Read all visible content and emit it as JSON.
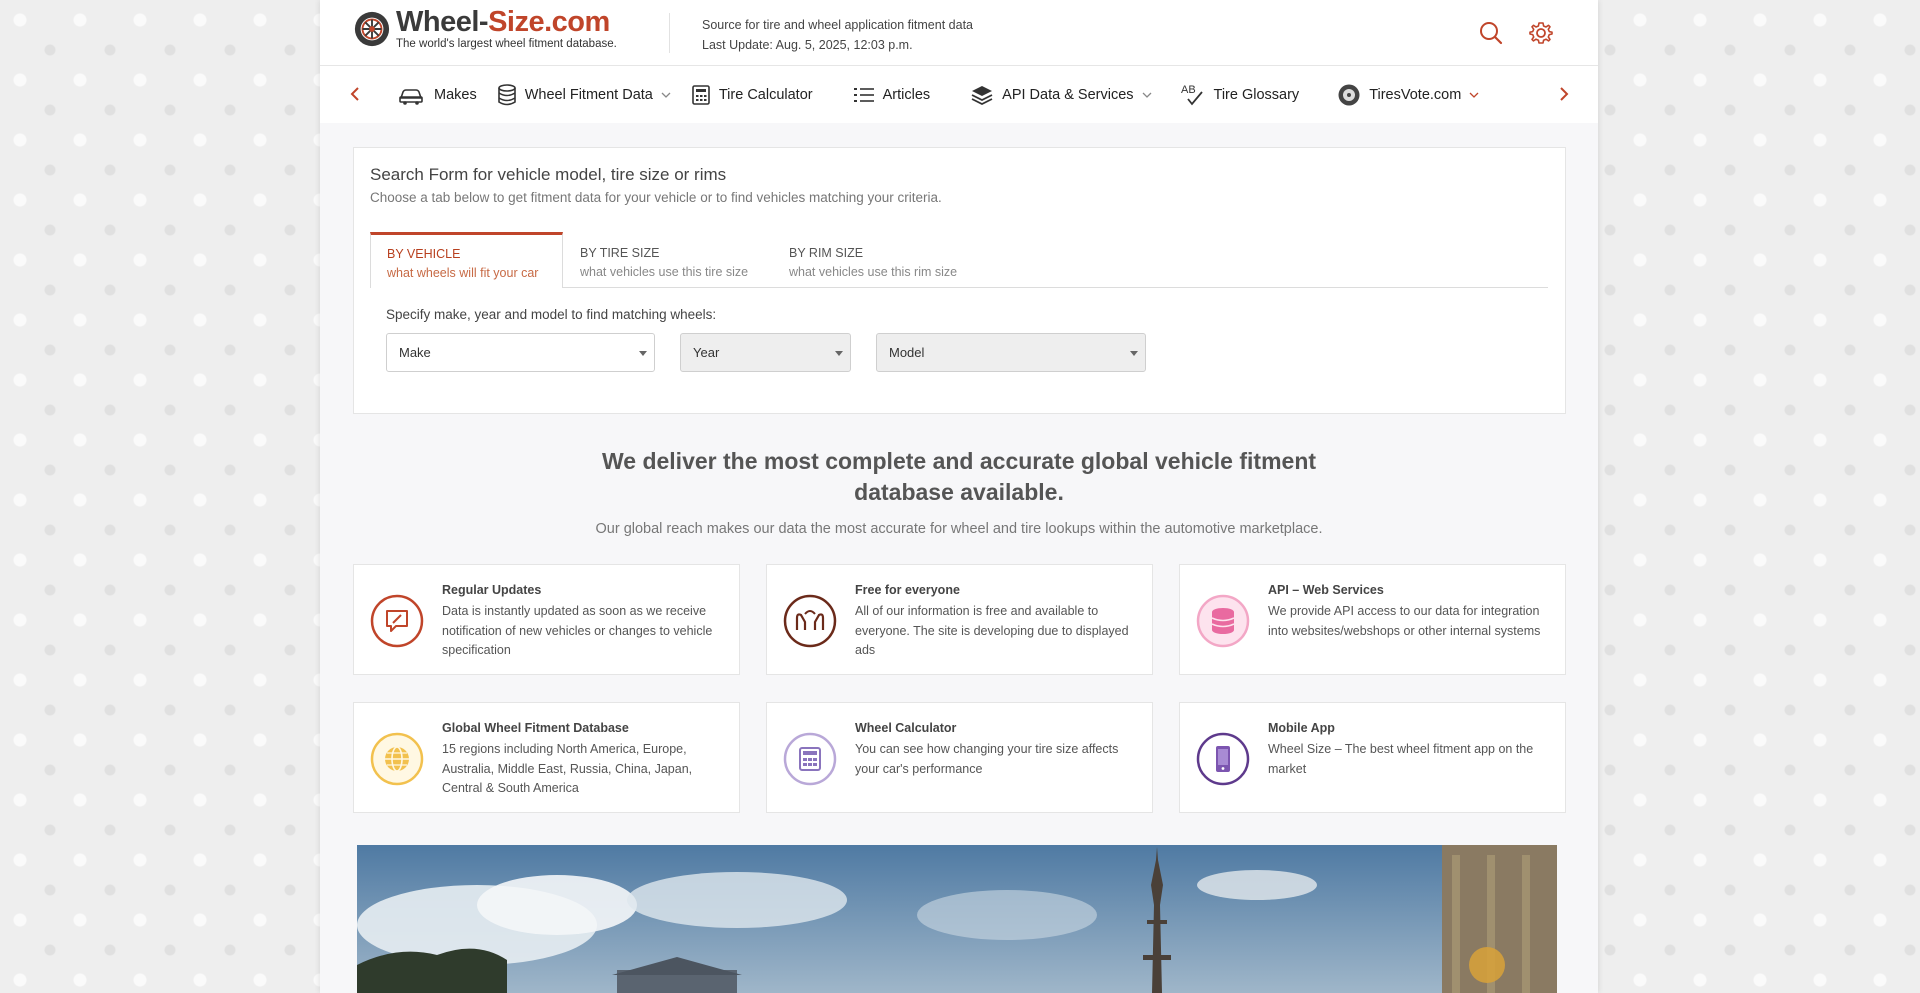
{
  "header": {
    "logo_main": "Wheel-",
    "logo_accent": "Size.com",
    "logo_tagline": "The world's largest wheel fitment database.",
    "info_line1": "Source for tire and wheel application fitment data",
    "info_line2": "Last Update: Aug. 5, 2025, 12:03 p.m.",
    "accent_color": "#c0452a"
  },
  "nav": {
    "items": [
      {
        "label": "Makes",
        "icon": "car-icon",
        "dropdown": false
      },
      {
        "label": "Wheel Fitment Data",
        "icon": "database-icon",
        "dropdown": true
      },
      {
        "label": "Tire Calculator",
        "icon": "calculator-icon",
        "dropdown": false
      },
      {
        "label": "Articles",
        "icon": "list-icon",
        "dropdown": false
      },
      {
        "label": "API Data & Services",
        "icon": "layers-icon",
        "dropdown": true
      },
      {
        "label": "Tire Glossary",
        "icon": "spellcheck-icon",
        "dropdown": false
      },
      {
        "label": "TiresVote.com",
        "icon": "tire-icon",
        "dropdown": true
      }
    ]
  },
  "search": {
    "title": "Search Form for vehicle model, tire size or rims",
    "subtitle": "Choose a tab below to get fitment data for your vehicle or to find vehicles matching your criteria.",
    "tabs": [
      {
        "label": "BY VEHICLE",
        "sub": "what wheels will fit your car",
        "active": true
      },
      {
        "label": "BY TIRE SIZE",
        "sub": "what vehicles use this tire size",
        "active": false
      },
      {
        "label": "BY RIM SIZE",
        "sub": "what vehicles use this rim size",
        "active": false
      }
    ],
    "form_label": "Specify make, year and model to find matching wheels:",
    "make": "Make",
    "year": "Year",
    "model": "Model"
  },
  "hero": {
    "headline": "We deliver the most complete and accurate global vehicle fitment database available.",
    "subline": "Our global reach makes our data the most accurate for wheel and tire lookups within the automotive marketplace."
  },
  "features": [
    {
      "title": "Regular Updates",
      "desc": "Data is instantly updated as soon as we receive notification of new vehicles or changes to vehicle specification",
      "color": "#c0452a",
      "icon": "edit-message-icon"
    },
    {
      "title": "Free for everyone",
      "desc": "All of our information is free and available to everyone. The site is developing due to displayed ads",
      "color": "#6b2a1a",
      "icon": "hands-icon"
    },
    {
      "title": "API – Web Services",
      "desc": "We provide API access to our data for integration into websites/webshops or other internal systems",
      "color": "#e96aa0",
      "icon": "database-stack-icon"
    },
    {
      "title": "Global Wheel Fitment Database",
      "desc": "15 regions including North America, Europe, Australia, Middle East, Russia, China, Japan, Central & South America",
      "color": "#f2c14e",
      "icon": "globe-icon"
    },
    {
      "title": "Wheel Calculator",
      "desc": "You can see how changing your tire size affects your car's performance",
      "color": "#9b86c4",
      "icon": "calculator-icon"
    },
    {
      "title": "Mobile App",
      "desc": "Wheel Size – The best wheel fitment app on the market",
      "color": "#5e3a8c",
      "icon": "mobile-icon"
    }
  ]
}
